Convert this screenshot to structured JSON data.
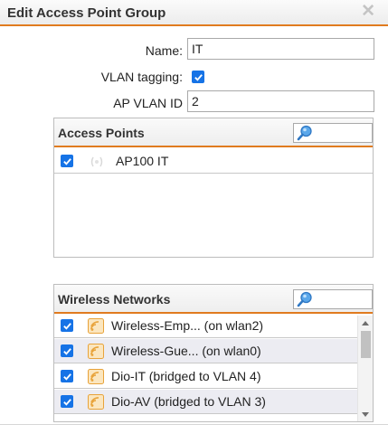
{
  "dialog": {
    "title": "Edit Access Point Group",
    "close_glyph": "✕"
  },
  "form": {
    "name_label": "Name:",
    "name_value": "IT",
    "vlan_tagging_label": "VLAN tagging:",
    "vlan_tagging_checked": true,
    "ap_vlan_id_label": "AP VLAN ID",
    "ap_vlan_id_value": "2"
  },
  "access_points": {
    "title": "Access Points",
    "search_value": "",
    "items": [
      {
        "label": "AP100 IT",
        "checked": true,
        "icon": "access-point-icon"
      }
    ]
  },
  "wireless_networks": {
    "title": "Wireless Networks",
    "search_value": "",
    "items": [
      {
        "label": "Wireless-Emp... (on wlan2)",
        "checked": true,
        "icon": "wifi-icon"
      },
      {
        "label": "Wireless-Gue... (on wlan0)",
        "checked": true,
        "icon": "wifi-icon"
      },
      {
        "label": "Dio-IT (bridged to VLAN 4)",
        "checked": true,
        "icon": "wifi-icon"
      },
      {
        "label": "Dio-AV (bridged to VLAN 3)",
        "checked": true,
        "icon": "wifi-icon"
      }
    ]
  },
  "colors": {
    "accent": "#e07b1f",
    "checkbox": "#1673e6",
    "wifi_icon": "#e8a33a"
  }
}
